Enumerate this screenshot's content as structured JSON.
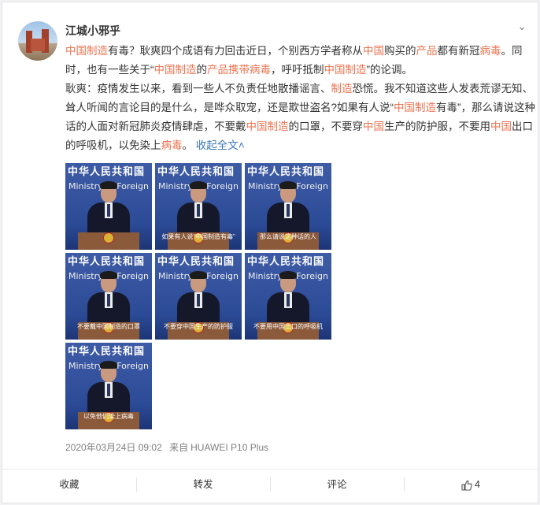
{
  "post": {
    "username": "江城小邪乎",
    "line1": [
      {
        "t": "中国制造",
        "h": true
      },
      {
        "t": "有毒？耿爽四个成语有力回击近日，个别西方学者称从"
      },
      {
        "t": "中国",
        "h": true
      },
      {
        "t": "购买的"
      },
      {
        "t": "产品",
        "h": true
      },
      {
        "t": "都有新冠"
      },
      {
        "t": "病毒",
        "h": true
      },
      {
        "t": "。同时，也有一些关于“"
      },
      {
        "t": "中国制造",
        "h": true
      },
      {
        "t": "的"
      },
      {
        "t": "产品携带病毒",
        "h": true
      },
      {
        "t": "，呼吁抵制"
      },
      {
        "t": "中国制造",
        "h": true
      },
      {
        "t": "”的论调。"
      }
    ],
    "line2": [
      {
        "t": "耿爽：疫情发生以来，看到一些人不负责任地散播谣言、"
      },
      {
        "t": "制造",
        "h": true
      },
      {
        "t": "恐慌。我不知道这些人发表荒谬无知、耸人听闻的言论目的是什么，是哗众取宠，还是欺世盗名?如果有人说“"
      },
      {
        "t": "中国制造",
        "h": true
      },
      {
        "t": "有毒”，那么请说这种话的人面对新冠肺炎疫情肆虐，不要戴"
      },
      {
        "t": "中国制造",
        "h": true
      },
      {
        "t": "的口罩，不要穿"
      },
      {
        "t": "中国",
        "h": true
      },
      {
        "t": "生产的防护服，不要用"
      },
      {
        "t": "中国",
        "h": true
      },
      {
        "t": "出口的呼吸机，以免染上"
      },
      {
        "t": "病毒",
        "h": true
      },
      {
        "t": "。 "
      }
    ],
    "collapse_label": "收起全文",
    "collapse_icon": "chevron-up-icon",
    "images": [
      {
        "subtitle": ""
      },
      {
        "subtitle": "如果有人说“中国制造有毒”"
      },
      {
        "subtitle": "那么请说这种话的人"
      },
      {
        "subtitle": ""
      },
      {
        "subtitle": "不要戴中国制造的口罩"
      },
      {
        "subtitle": "不要穿中国生产的防护服"
      },
      {
        "subtitle": "不要用中国出口的呼吸机"
      },
      {
        "subtitle": ""
      },
      {
        "subtitle": ""
      },
      {
        "subtitle": ""
      },
      {
        "subtitle": ""
      },
      {
        "subtitle": ""
      },
      {
        "subtitle": ""
      },
      {
        "subtitle": "以免他们染上病毒"
      }
    ],
    "image_wall_text": "中华人民共和国",
    "image_wall_text2": "Ministry of Foreign",
    "timestamp": "2020年03月24日 09:02",
    "source_prefix": "来自",
    "source_device": "HUAWEI P10 Plus"
  },
  "actions": {
    "favorite": "收藏",
    "repost": "转发",
    "comment": "评论",
    "like_count": "4"
  },
  "colors": {
    "highlight": "#eb7350",
    "link": "#3a77b9"
  }
}
